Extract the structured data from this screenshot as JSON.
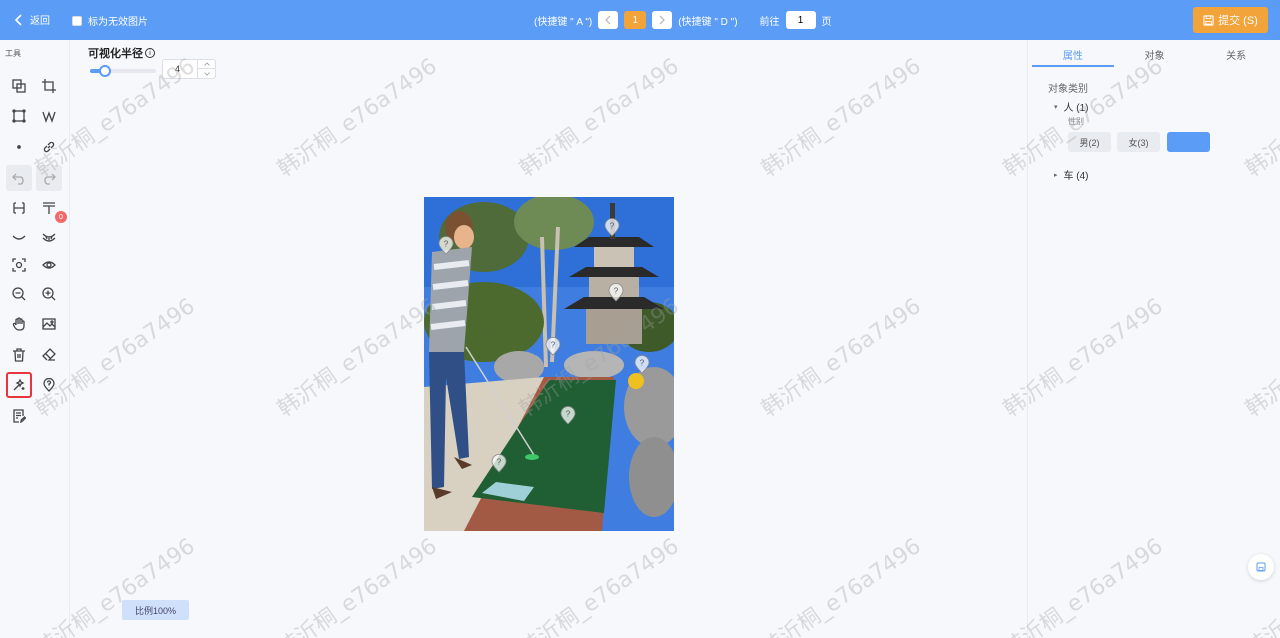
{
  "topbar": {
    "back_label": "返回",
    "invalid_label": "标为无效图片",
    "prev_hint": "(快捷键 \" A \")",
    "current_page": "1",
    "next_hint": "(快捷键 \" D \")",
    "goto_prefix": "前往",
    "goto_value": "1",
    "goto_suffix": "页",
    "submit_label": "提交 (S)",
    "accent_color": "#5b9cf6",
    "submit_color": "#f2a33a"
  },
  "toolbar": {
    "title": "工具",
    "tools": [
      "copy-polygon-icon",
      "crop-icon",
      "rectangle-icon",
      "polyline-icon",
      "point-icon",
      "link-icon",
      "undo-icon",
      "redo-icon",
      "flip-horizontal-icon",
      "flip-vertical-icon",
      "curve-icon",
      "multi-curve-icon",
      "focus-icon",
      "eye-icon",
      "zoom-out-icon",
      "zoom-in-icon",
      "hand-icon",
      "image-icon",
      "trash-icon",
      "eraser-icon",
      "magic-brush-icon",
      "location-pin-icon",
      "notes-icon"
    ],
    "hidden_count": "0"
  },
  "radius": {
    "label": "可视化半径",
    "info": "i",
    "value": "4",
    "level_fraction": 0.22
  },
  "canvas": {
    "scale_label": "比例100%"
  },
  "right_panel": {
    "tabs": [
      "属性",
      "对象",
      "关系"
    ],
    "active_tab": 0,
    "category_label": "对象类别",
    "tree": [
      {
        "label": "人 (1)",
        "expanded": true,
        "attr_label": "性别",
        "options": [
          "男(2)",
          "女(3)",
          ""
        ]
      },
      {
        "label": "车 (4)",
        "expanded": false
      }
    ]
  },
  "watermark_text": "韩沂桐_e76a7496"
}
